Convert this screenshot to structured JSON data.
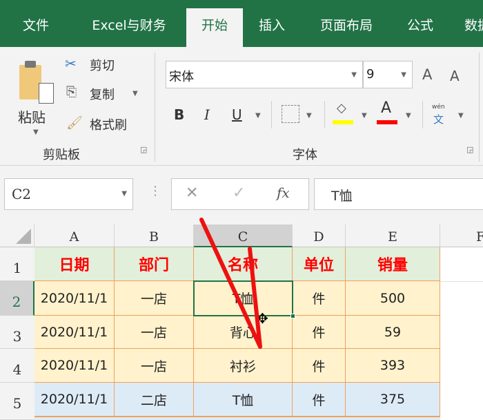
{
  "tabs": [
    "文件",
    "Excel与财务",
    "开始",
    "插入",
    "页面布局",
    "公式",
    "数据"
  ],
  "active_tab": "开始",
  "clipboard": {
    "paste": "粘贴",
    "cut": "剪切",
    "copy": "复制",
    "format_painter": "格式刷",
    "group": "剪贴板"
  },
  "font": {
    "name": "宋体",
    "size": "9",
    "bold": "B",
    "italic": "I",
    "underline": "U",
    "font_color_glyph": "A",
    "grow": "A",
    "shrink": "A",
    "phonetic_top": "wén",
    "phonetic_bottom": "文",
    "group": "字体",
    "fill_color": "#ffff00",
    "font_color": "#ff0000"
  },
  "formula_bar": {
    "name_box": "C2",
    "fx": "fx",
    "cancel": "✕",
    "enter": "✓",
    "value": "T恤"
  },
  "columns": [
    "A",
    "B",
    "C",
    "D",
    "E",
    "F"
  ],
  "rows": [
    "1",
    "2",
    "3",
    "4",
    "5"
  ],
  "header": [
    "日期",
    "部门",
    "名称",
    "单位",
    "销量"
  ],
  "data": [
    [
      "2020/11/1",
      "一店",
      "T恤",
      "件",
      "500"
    ],
    [
      "2020/11/1",
      "一店",
      "背心",
      "件",
      "59"
    ],
    [
      "2020/11/1",
      "一店",
      "衬衫",
      "件",
      "393"
    ],
    [
      "2020/11/1",
      "二店",
      "T恤",
      "件",
      "375"
    ]
  ],
  "colors": {
    "accent": "#217346",
    "header_fill": "#e2efda",
    "store1_fill": "#fff2cc",
    "store2_fill": "#ddebf7",
    "header_text": "#ff0000",
    "border": "#f0a05a"
  }
}
